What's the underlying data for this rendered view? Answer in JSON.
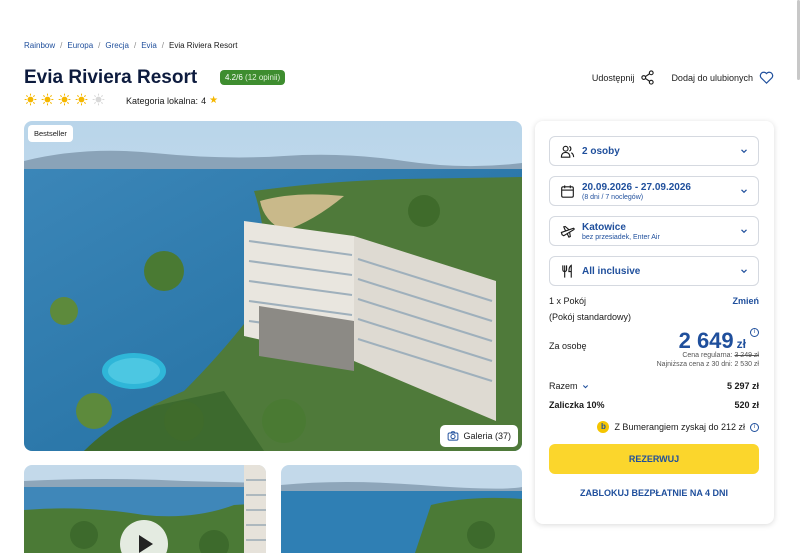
{
  "breadcrumb": [
    "Rainbow",
    "Europa",
    "Grecja",
    "Evia",
    "Evia Riviera Resort"
  ],
  "breadcrumb_separator": "/",
  "hotel": {
    "title": "Evia Riviera Resort",
    "rating_score": "4.2/6",
    "rating_count": "(12 opinii)",
    "sun_rating": 4.5,
    "local_category_label": "Kategoria lokalna:",
    "local_category_value": "4"
  },
  "actions": {
    "share_label": "Udostępnij",
    "favorite_label": "Dodaj do ulubionych"
  },
  "gallery": {
    "badge": "Bestseller",
    "button_label": "Galeria (37)"
  },
  "booking": {
    "travelers": "2 osoby",
    "dates": "20.09.2026 - 27.09.2026",
    "dates_sub": "(8 dni / 7 noclegów)",
    "departure": "Katowice",
    "departure_sub": "bez przesiadek, Enter Air",
    "board": "All inclusive",
    "room_count": "1 x Pokój",
    "room_change": "Zmień",
    "room_type": "(Pokój standardowy)",
    "per_person_label": "Za osobę",
    "price": "2 649",
    "currency": "zł",
    "regular_label": "Cena regularna:",
    "regular_price": "3 249 zł",
    "lowest_label": "Najniższa cena z 30 dni:",
    "lowest_price": "2 530 zł",
    "total_label": "Razem",
    "total_value": "5 297 zł",
    "deposit_label": "Zaliczka 10%",
    "deposit_value": "520 zł",
    "bumerang_text": "Z Bumerangiem zyskaj do 212 zł",
    "reserve_label": "REZERWUJ",
    "block_label": "ZABLOKUJ BEZPŁATNIE NA 4 DNI"
  },
  "colors": {
    "brand_blue": "#1f4f9c",
    "rating_green": "#3e8d2f",
    "cta_yellow": "#fbd62c",
    "sun": "#f5b700"
  }
}
